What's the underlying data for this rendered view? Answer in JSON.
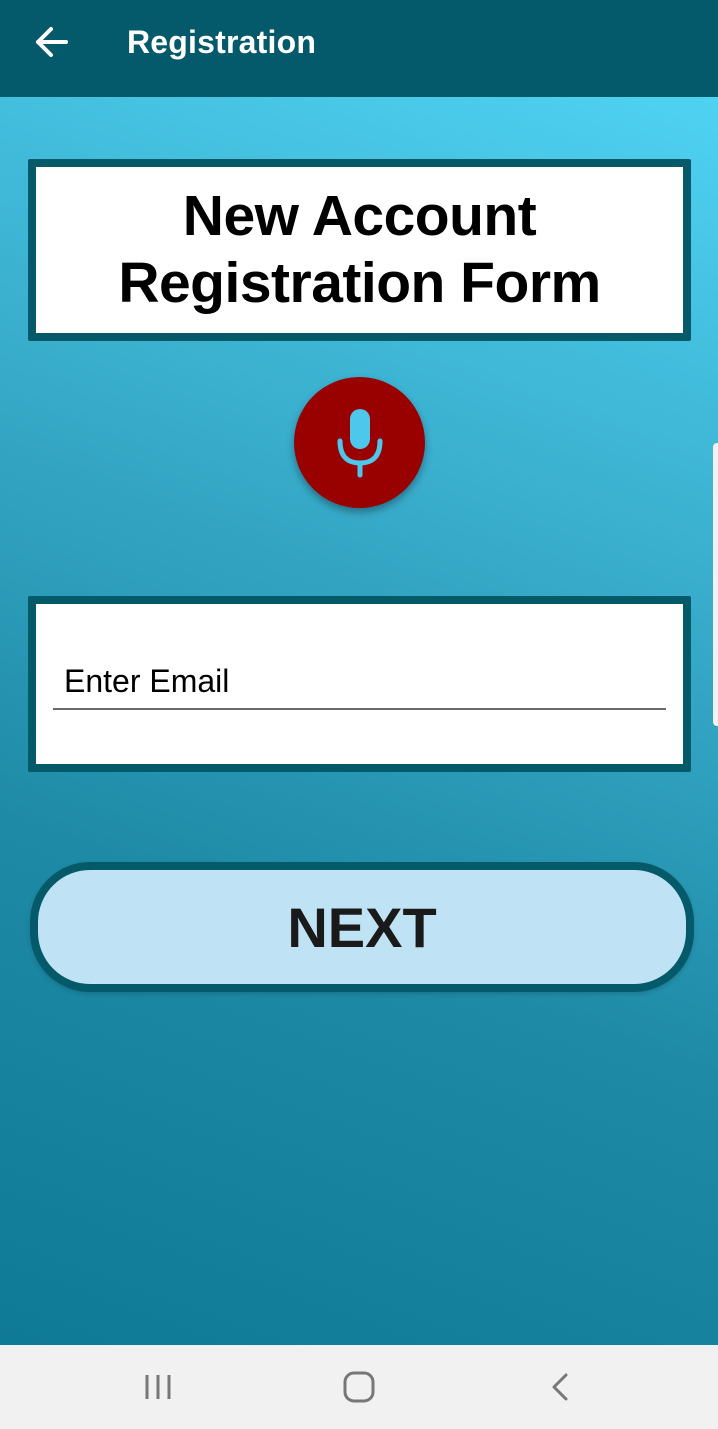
{
  "app_bar": {
    "title": "Registration",
    "back_icon": "arrow-left-icon",
    "background": "#045a6b"
  },
  "main": {
    "form_title": "New Account Registration Form",
    "mic_icon": "microphone-icon",
    "mic_color": "#990000",
    "email_field": {
      "placeholder": "Enter Email",
      "value": ""
    },
    "next_label": "NEXT"
  },
  "nav_bar": {
    "items": [
      "recent-apps-icon",
      "home-icon",
      "back-icon"
    ]
  },
  "colors": {
    "accent_dark": "#055a6a",
    "button_fill": "#bfe3f5",
    "mic_glyph": "#4dc8ec"
  }
}
